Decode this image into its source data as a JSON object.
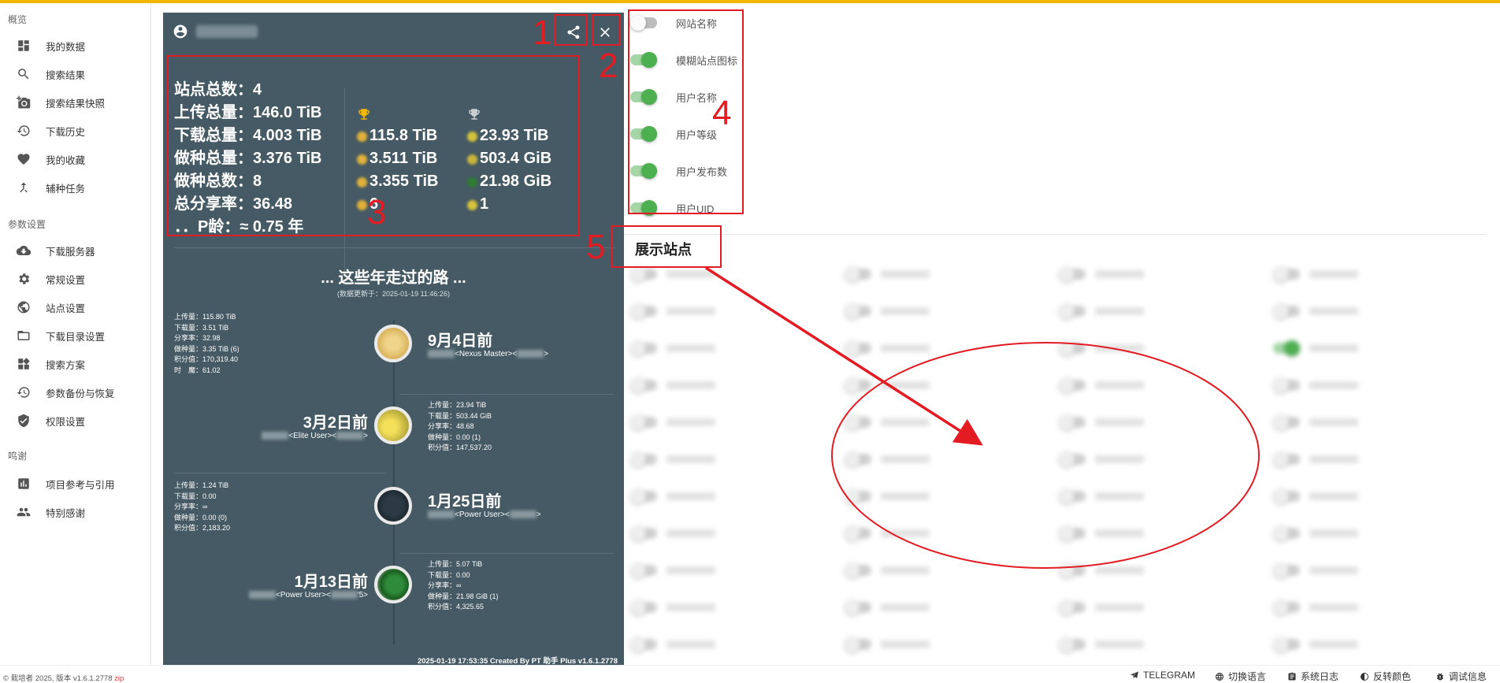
{
  "sidebar": {
    "sections": [
      "概览",
      "参数设置",
      "鸣谢"
    ],
    "items": [
      {
        "label": "我的数据",
        "icon": "dashboard-icon"
      },
      {
        "label": "搜索结果",
        "icon": "search-icon"
      },
      {
        "label": "搜索结果快照",
        "icon": "camera-icon"
      },
      {
        "label": "下载历史",
        "icon": "history-icon"
      },
      {
        "label": "我的收藏",
        "icon": "heart-icon"
      },
      {
        "label": "辅种任务",
        "icon": "merge-icon"
      },
      {
        "label": "下载服务器",
        "icon": "cloud-download-icon"
      },
      {
        "label": "常规设置",
        "icon": "gear-icon"
      },
      {
        "label": "站点设置",
        "icon": "globe-icon"
      },
      {
        "label": "下载目录设置",
        "icon": "folder-icon"
      },
      {
        "label": "搜索方案",
        "icon": "widgets-icon"
      },
      {
        "label": "参数备份与恢复",
        "icon": "restore-icon"
      },
      {
        "label": "权限设置",
        "icon": "shield-icon"
      },
      {
        "label": "项目参考与引用",
        "icon": "reference-icon"
      },
      {
        "label": "特别感谢",
        "icon": "people-icon"
      }
    ]
  },
  "panel": {
    "bg_color": "#455a64",
    "summary": {
      "rows": [
        {
          "label": "站点总数：",
          "value": "4"
        },
        {
          "label": "上传总量：",
          "value": "146.0 TiB"
        },
        {
          "label": "下载总量：",
          "value": "4.003 TiB"
        },
        {
          "label": "做种总量：",
          "value": "3.376 TiB"
        },
        {
          "label": "做种总数：",
          "value": "8"
        },
        {
          "label": "总分享率：",
          "value": "36.48"
        },
        {
          "label": "．．P龄：",
          "value": "≈ 0.75 年"
        }
      ],
      "gold_values": [
        "115.8 TiB",
        "3.511 TiB",
        "3.355 TiB",
        "6"
      ],
      "silver_values": [
        "23.93 TiB",
        "503.4 GiB",
        "21.98 GiB",
        "1"
      ]
    },
    "journey": {
      "title": "... 这些年走过的路 ...",
      "updated": "(数据更新于：2025-01-19 11:46:26)",
      "events": [
        {
          "date": "9月4日前",
          "role": "<Nexus Master><",
          "role_end": ">",
          "stats": [
            "上传量：115.80 TiB",
            "下载量：3.51 TiB",
            "分享率：32.98",
            "做种量：3.35 TiB (6)",
            "积分值：170,319.40",
            "时　魔：61.02"
          ]
        },
        {
          "date": "3月2日前",
          "role": "<Elite User><",
          "role_end": ">",
          "stats": [
            "上传量：23.94 TiB",
            "下载量：503.44 GiB",
            "分享率：48.68",
            "做种量：0.00 (1)",
            "积分值：147,537.20"
          ]
        },
        {
          "date": "1月25日前",
          "role": "<Power User><",
          "role_end": ">",
          "stats": [
            "上传量：1.24 TiB",
            "下载量：0.00",
            "分享率：∞",
            "做种量：0.00 (0)",
            "积分值：2,183.20"
          ]
        },
        {
          "date": "1月13日前",
          "role": "<Power User><",
          "role_end": "'5>",
          "stats": [
            "上传量：5.07 TiB",
            "下载量：0.00",
            "分享率：∞",
            "做种量：21.98 GiB (1)",
            "积分值：4,325.65"
          ]
        }
      ]
    },
    "footer": "2025-01-19 17:53:35 Created By PT 助手 Plus v1.6.1.2778"
  },
  "options": [
    {
      "label": "网站名称",
      "on": false
    },
    {
      "label": "模糊站点图标",
      "on": true
    },
    {
      "label": "用户名称",
      "on": true
    },
    {
      "label": "用户等级",
      "on": true
    },
    {
      "label": "用户发布数",
      "on": true
    },
    {
      "label": "用户UID",
      "on": true
    }
  ],
  "sites_title": "展示站点",
  "annotations": [
    "1",
    "2",
    "3",
    "4",
    "5"
  ],
  "annotation_color": "#e31b23",
  "footer": {
    "copyright": "© 栽培者 2025, 版本 v1.6.1.2778",
    "zip": "zip",
    "buttons": [
      {
        "label": "TELEGRAM",
        "icon": "telegram-icon"
      },
      {
        "label": "切换语言",
        "icon": "globe-icon"
      },
      {
        "label": "系统日志",
        "icon": "log-icon"
      },
      {
        "label": "反转颜色",
        "icon": "invert-icon"
      },
      {
        "label": "调试信息",
        "icon": "bug-icon"
      }
    ]
  }
}
